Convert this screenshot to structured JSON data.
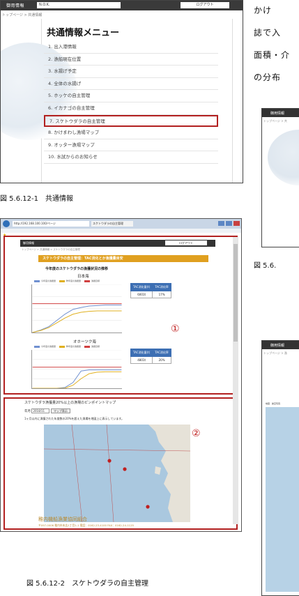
{
  "shot1": {
    "brand": "御用情報",
    "user": "N.O.K.",
    "logout": "ログアウト",
    "breadcrumb": "トップページ > 共通情報",
    "title": "共通情報メニュー",
    "menu": [
      "1. 出入港情報",
      "2. 漁船現在位置",
      "3. 水揚げ予定",
      "4. 全体の水揚げ",
      "5. ホッケの自主管理",
      "6. イカナゴの自主管理",
      "7. スケトウダラの自主管理",
      "8. かけまわし漁場マップ",
      "9. オッター漁場マップ",
      "10. 水試からのお知らせ"
    ],
    "highlighted_index": 6
  },
  "caption1": "図 5.6.12-1　共通情報",
  "shot2": {
    "url": "http://192.168.100.100/ページ",
    "tab": "スケトウダラの自主管理",
    "brand": "御用情報",
    "logout": "ログアウト",
    "breadcrumb": "トップページ > 共通情報 > スケトウダラの自主管理",
    "banner": "スケトウダラの自主管理：TAC消化とか漁獲量目安",
    "section_title": "今年度のスケトウダラの漁獲状況の推移",
    "chart1_title": "日本海",
    "chart2_title": "オホーツク海",
    "legend": [
      "今年度の漁獲量",
      "昨年度の漁獲量",
      "漁獲目標"
    ],
    "table_headers": [
      "TAC消化量(t)",
      "TAC消化率"
    ],
    "table1_values": [
      "6001t",
      "17%"
    ],
    "table2_values": [
      "4801t",
      "20%"
    ],
    "marker1": "①",
    "map_title": "スケトウダラ漁獲量20%以上の漁場のピンポイントマップ",
    "date_label": "年月",
    "date_value": "2018/11",
    "date_button": "マップ表示",
    "map_note": "1ヶ月以内に漁獲された年度数の20%を超えた漁場を地図上に表示しています。",
    "marker2": "②",
    "footer_org": "稚内機船漁業協同組合",
    "footer_addr": "〒097-0006 稚内市末広1丁目1-1 電話：0162-23-4100 FAX：0162-24-1125"
  },
  "caption2": "図 5.6.12-2　スケトウダラの自主管理",
  "right_text": [
    "かけ",
    "誌で入",
    "面積・介",
    "の分布"
  ],
  "shot3": {
    "brand": "御用情報",
    "crumb": "トップページ > 共"
  },
  "caption3": "図 5.6.",
  "shot4": {
    "brand": "御用情報",
    "crumb": "トップページ > 漁",
    "tabs": "地図　航空写真"
  },
  "colors": {
    "highlight": "#b22020",
    "banner": "#e0a020",
    "table_header": "#3d6fb3",
    "series_this_year": "#7090d0",
    "series_last_year": "#e0b020",
    "series_target": "#d04040"
  },
  "chart_data": [
    {
      "type": "line",
      "title": "日本海",
      "series": [
        {
          "name": "今年度の漁獲量",
          "values": [
            0,
            5,
            12,
            25,
            38,
            48,
            52,
            55,
            56,
            57,
            57,
            57
          ]
        },
        {
          "name": "昨年度の漁獲量",
          "values": [
            0,
            4,
            10,
            20,
            30,
            38,
            42,
            44,
            45,
            45,
            45,
            45
          ]
        },
        {
          "name": "漁獲目標",
          "values": [
            60,
            60,
            60,
            60,
            60,
            60,
            60,
            60,
            60,
            60,
            60,
            60
          ]
        }
      ],
      "ylim": [
        0,
        100
      ]
    },
    {
      "type": "line",
      "title": "オホーツク海",
      "series": [
        {
          "name": "今年度の漁獲量",
          "values": [
            0,
            0,
            0,
            0,
            2,
            15,
            45,
            48,
            48,
            48,
            48,
            48
          ]
        },
        {
          "name": "昨年度の漁獲量",
          "values": [
            0,
            0,
            0,
            0,
            0,
            8,
            25,
            38,
            42,
            43,
            43,
            43
          ]
        },
        {
          "name": "漁獲目標",
          "values": [
            55,
            55,
            55,
            55,
            55,
            55,
            55,
            55,
            55,
            55,
            55,
            55
          ]
        }
      ],
      "ylim": [
        0,
        100
      ]
    }
  ]
}
